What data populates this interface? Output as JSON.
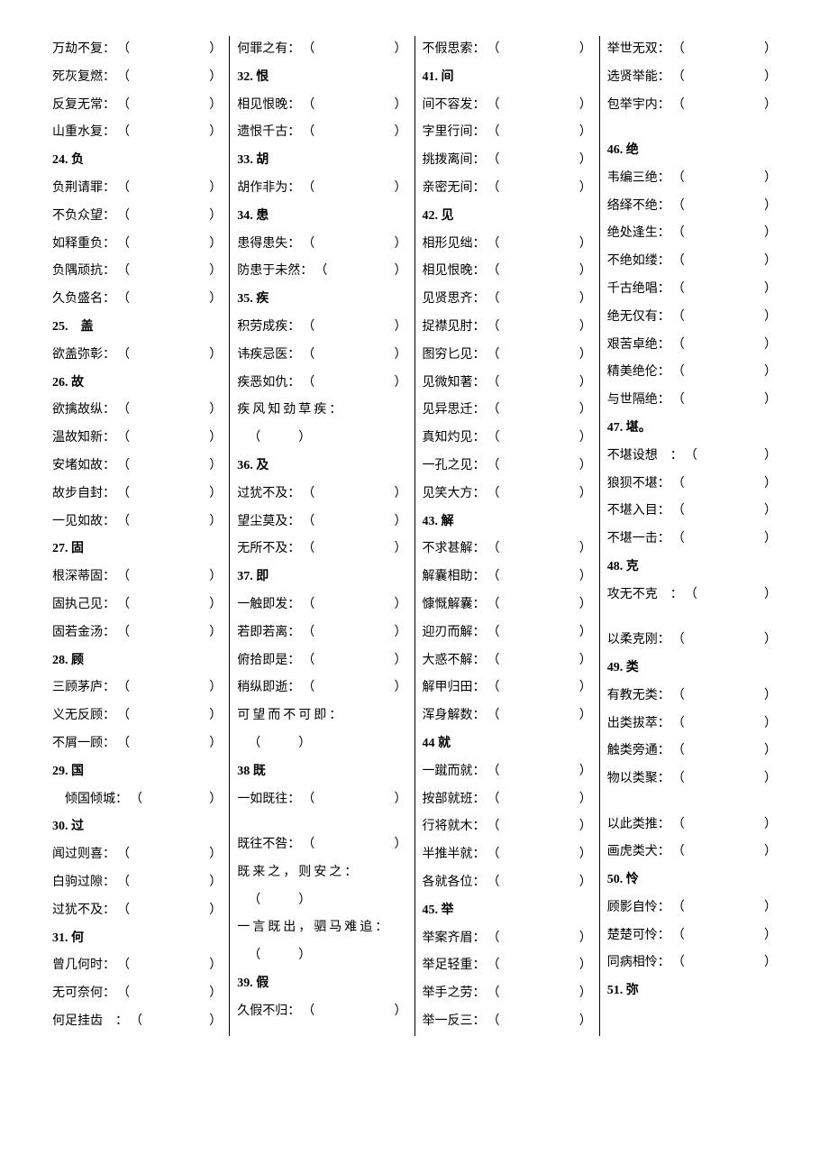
{
  "columns": [
    [
      {
        "type": "entry",
        "text": "万劫不复："
      },
      {
        "type": "entry",
        "text": "死灰复燃："
      },
      {
        "type": "entry",
        "text": "反复无常："
      },
      {
        "type": "entry",
        "text": "山重水复："
      },
      {
        "type": "heading",
        "text": "24. 负"
      },
      {
        "type": "entry",
        "text": "负荆请罪："
      },
      {
        "type": "entry",
        "text": "不负众望："
      },
      {
        "type": "entry",
        "text": "如释重负："
      },
      {
        "type": "entry",
        "text": "负隅顽抗："
      },
      {
        "type": "entry",
        "text": "久负盛名："
      },
      {
        "type": "heading",
        "text": "25.　盖"
      },
      {
        "type": "entry",
        "text": "欲盖弥彰："
      },
      {
        "type": "heading",
        "text": "26. 故"
      },
      {
        "type": "entry",
        "text": "欲擒故纵："
      },
      {
        "type": "entry",
        "text": "温故知新："
      },
      {
        "type": "entry",
        "text": "安堵如故："
      },
      {
        "type": "entry",
        "text": "故步自封："
      },
      {
        "type": "entry",
        "text": "一见如故："
      },
      {
        "type": "heading",
        "text": "27. 固"
      },
      {
        "type": "entry",
        "text": "根深蒂固："
      },
      {
        "type": "entry",
        "text": "固执己见："
      },
      {
        "type": "entry",
        "text": "固若金汤："
      },
      {
        "type": "heading",
        "text": "28. 顾"
      },
      {
        "type": "entry",
        "text": "三顾茅庐："
      },
      {
        "type": "entry",
        "text": "义无反顾："
      },
      {
        "type": "entry",
        "text": "不屑一顾："
      },
      {
        "type": "heading",
        "text": "29. 国"
      },
      {
        "type": "entry",
        "text": "倾国倾城：",
        "indent": true
      },
      {
        "type": "heading",
        "text": "30. 过"
      },
      {
        "type": "entry",
        "text": "闻过则喜："
      },
      {
        "type": "entry",
        "text": "白驹过隙："
      },
      {
        "type": "entry",
        "text": "过犹不及："
      },
      {
        "type": "heading",
        "text": "31. 何"
      },
      {
        "type": "entry",
        "text": "曾几何时："
      },
      {
        "type": "entry",
        "text": "无可奈何："
      },
      {
        "type": "entry",
        "text": "何足挂齿　："
      }
    ],
    [
      {
        "type": "entry",
        "text": "何罪之有："
      },
      {
        "type": "heading",
        "text": "32. 恨"
      },
      {
        "type": "entry",
        "text": "相见恨晚："
      },
      {
        "type": "entry",
        "text": "遗恨千古："
      },
      {
        "type": "heading",
        "text": "33. 胡"
      },
      {
        "type": "entry",
        "text": "胡作非为："
      },
      {
        "type": "heading",
        "text": "34. 患"
      },
      {
        "type": "entry",
        "text": "患得患失："
      },
      {
        "type": "entry",
        "text": "防患于未然："
      },
      {
        "type": "heading",
        "text": "35. 疾"
      },
      {
        "type": "entry",
        "text": "积劳成疾："
      },
      {
        "type": "entry",
        "text": "讳疾忌医："
      },
      {
        "type": "entry",
        "text": "疾恶如仇："
      },
      {
        "type": "multi",
        "text": "疾风知劲草疾："
      },
      {
        "type": "paren"
      },
      {
        "type": "heading",
        "text": "36. 及"
      },
      {
        "type": "entry",
        "text": "过犹不及："
      },
      {
        "type": "entry",
        "text": "望尘莫及："
      },
      {
        "type": "entry",
        "text": "无所不及："
      },
      {
        "type": "heading",
        "text": "37. 即"
      },
      {
        "type": "entry",
        "text": "一触即发："
      },
      {
        "type": "entry",
        "text": "若即若离："
      },
      {
        "type": "entry",
        "text": "俯拾即是："
      },
      {
        "type": "entry",
        "text": "稍纵即逝："
      },
      {
        "type": "multi",
        "text": "可望而不可即："
      },
      {
        "type": "paren"
      },
      {
        "type": "heading",
        "text": "38 既"
      },
      {
        "type": "entry",
        "text": "一如既往："
      },
      {
        "type": "blank"
      },
      {
        "type": "entry",
        "text": "既往不咎："
      },
      {
        "type": "multi",
        "text": "既来之，则安之："
      },
      {
        "type": "paren"
      },
      {
        "type": "multi",
        "text": "一言既出，驷马难追："
      },
      {
        "type": "paren"
      },
      {
        "type": "heading",
        "text": "39. 假"
      },
      {
        "type": "entry",
        "text": "久假不归："
      }
    ],
    [
      {
        "type": "entry",
        "text": "不假思索："
      },
      {
        "type": "heading",
        "text": "41. 间"
      },
      {
        "type": "entry",
        "text": "间不容发："
      },
      {
        "type": "entry",
        "text": "字里行间："
      },
      {
        "type": "entry",
        "text": "挑拨离间："
      },
      {
        "type": "entry",
        "text": "亲密无间："
      },
      {
        "type": "heading",
        "text": "42. 见"
      },
      {
        "type": "entry",
        "text": "相形见绌："
      },
      {
        "type": "entry",
        "text": "相见恨晚："
      },
      {
        "type": "entry",
        "text": "见贤思齐："
      },
      {
        "type": "entry",
        "text": "捉襟见肘："
      },
      {
        "type": "entry",
        "text": "图穷匕见："
      },
      {
        "type": "entry",
        "text": "见微知著："
      },
      {
        "type": "entry",
        "text": "见异思迁："
      },
      {
        "type": "entry",
        "text": "真知灼见："
      },
      {
        "type": "entry",
        "text": "一孔之见："
      },
      {
        "type": "entry",
        "text": "见笑大方："
      },
      {
        "type": "heading",
        "text": "43. 解"
      },
      {
        "type": "entry",
        "text": "不求甚解："
      },
      {
        "type": "entry",
        "text": "解囊相助："
      },
      {
        "type": "entry",
        "text": "慷慨解囊："
      },
      {
        "type": "entry",
        "text": "迎刃而解："
      },
      {
        "type": "entry",
        "text": "大惑不解："
      },
      {
        "type": "entry",
        "text": "解甲归田："
      },
      {
        "type": "entry",
        "text": "浑身解数："
      },
      {
        "type": "heading",
        "text": "44 就"
      },
      {
        "type": "entry",
        "text": "一蹴而就："
      },
      {
        "type": "entry",
        "text": "按部就班："
      },
      {
        "type": "entry",
        "text": "行将就木："
      },
      {
        "type": "entry",
        "text": "半推半就："
      },
      {
        "type": "entry",
        "text": "各就各位："
      },
      {
        "type": "heading",
        "text": "45. 举"
      },
      {
        "type": "entry",
        "text": "举案齐眉："
      },
      {
        "type": "entry",
        "text": "举足轻重："
      },
      {
        "type": "entry",
        "text": "举手之劳："
      },
      {
        "type": "entry",
        "text": "举一反三："
      }
    ],
    [
      {
        "type": "entry",
        "text": "举世无双："
      },
      {
        "type": "entry",
        "text": "选贤举能："
      },
      {
        "type": "entry",
        "text": "包举宇内："
      },
      {
        "type": "blank"
      },
      {
        "type": "heading",
        "text": "46. 绝"
      },
      {
        "type": "entry",
        "text": "韦编三绝："
      },
      {
        "type": "entry",
        "text": "络绎不绝："
      },
      {
        "type": "entry",
        "text": "绝处逢生："
      },
      {
        "type": "entry",
        "text": "不绝如缕："
      },
      {
        "type": "entry",
        "text": "千古绝唱："
      },
      {
        "type": "entry",
        "text": "绝无仅有："
      },
      {
        "type": "entry",
        "text": "艰苦卓绝："
      },
      {
        "type": "entry",
        "text": "精美绝伦："
      },
      {
        "type": "entry",
        "text": "与世隔绝："
      },
      {
        "type": "heading",
        "text": "47. 堪。"
      },
      {
        "type": "entry",
        "text": "不堪设想　："
      },
      {
        "type": "entry",
        "text": "狼狈不堪："
      },
      {
        "type": "entry",
        "text": "不堪入目："
      },
      {
        "type": "entry",
        "text": "不堪一击："
      },
      {
        "type": "heading",
        "text": "48. 克"
      },
      {
        "type": "entry",
        "text": "攻无不克　："
      },
      {
        "type": "blank"
      },
      {
        "type": "entry",
        "text": "以柔克刚："
      },
      {
        "type": "heading",
        "text": "49. 类"
      },
      {
        "type": "entry",
        "text": "有教无类："
      },
      {
        "type": "entry",
        "text": "出类拔萃："
      },
      {
        "type": "entry",
        "text": "触类旁通："
      },
      {
        "type": "entry",
        "text": "物以类聚："
      },
      {
        "type": "blank"
      },
      {
        "type": "entry",
        "text": "以此类推："
      },
      {
        "type": "entry",
        "text": "画虎类犬："
      },
      {
        "type": "heading",
        "text": "50. 怜"
      },
      {
        "type": "entry",
        "text": "顾影自怜："
      },
      {
        "type": "entry",
        "text": "楚楚可怜："
      },
      {
        "type": "entry",
        "text": "同病相怜："
      },
      {
        "type": "heading",
        "text": "51. 弥"
      }
    ]
  ]
}
